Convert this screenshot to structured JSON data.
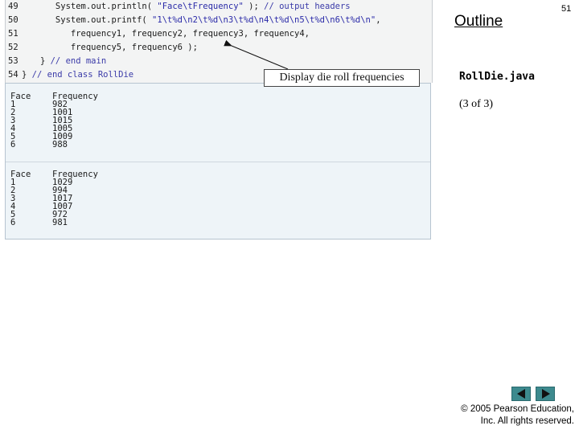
{
  "slide": {
    "outline_title": "Outline",
    "slide_number": "51",
    "file_name": "RollDie.java",
    "part_label": "(3 of 3)"
  },
  "callout": {
    "text": "Display die roll frequencies"
  },
  "code": {
    "lines": [
      {
        "num": "49",
        "segments": [
          {
            "text": "      System.out.println( ",
            "cls": "plain"
          },
          {
            "text": "\"Face\\tFrequency\"",
            "cls": "str"
          },
          {
            "text": " ); ",
            "cls": "plain"
          },
          {
            "text": "// output headers",
            "cls": "cmt"
          }
        ]
      },
      {
        "num": "50",
        "segments": [
          {
            "text": "      System.out.printf( ",
            "cls": "plain"
          },
          {
            "text": "\"1\\t%d\\n2\\t%d\\n3\\t%d\\n4\\t%d\\n5\\t%d\\n6\\t%d\\n\"",
            "cls": "str"
          },
          {
            "text": ",",
            "cls": "plain"
          }
        ]
      },
      {
        "num": "51",
        "segments": [
          {
            "text": "         frequency1, frequency2, frequency3, frequency4,",
            "cls": "plain"
          }
        ]
      },
      {
        "num": "52",
        "segments": [
          {
            "text": "         frequency5, frequency6 );",
            "cls": "plain"
          }
        ]
      },
      {
        "num": "53",
        "segments": [
          {
            "text": "   } ",
            "cls": "plain"
          },
          {
            "text": "// end main",
            "cls": "cmt"
          }
        ]
      },
      {
        "num": "54",
        "segments": [
          {
            "text": "} ",
            "cls": "plain"
          },
          {
            "text": "// end class RollDie",
            "cls": "cmt"
          }
        ]
      }
    ]
  },
  "output": {
    "runs": [
      {
        "header": [
          "Face",
          "Frequency"
        ],
        "rows": [
          [
            "1",
            "982"
          ],
          [
            "2",
            "1001"
          ],
          [
            "3",
            "1015"
          ],
          [
            "4",
            "1005"
          ],
          [
            "5",
            "1009"
          ],
          [
            "6",
            "988"
          ]
        ]
      },
      {
        "header": [
          "Face",
          "Frequency"
        ],
        "rows": [
          [
            "1",
            "1029"
          ],
          [
            "2",
            "994"
          ],
          [
            "3",
            "1017"
          ],
          [
            "4",
            "1007"
          ],
          [
            "5",
            "972"
          ],
          [
            "6",
            "981"
          ]
        ]
      }
    ]
  },
  "footer": {
    "copyright_line1": "© 2005 Pearson Education,",
    "copyright_line2": "Inc.  All rights reserved."
  },
  "nav": {
    "prev_icon": "triangle-left",
    "next_icon": "triangle-right",
    "button_color": "#3d8a8e"
  }
}
